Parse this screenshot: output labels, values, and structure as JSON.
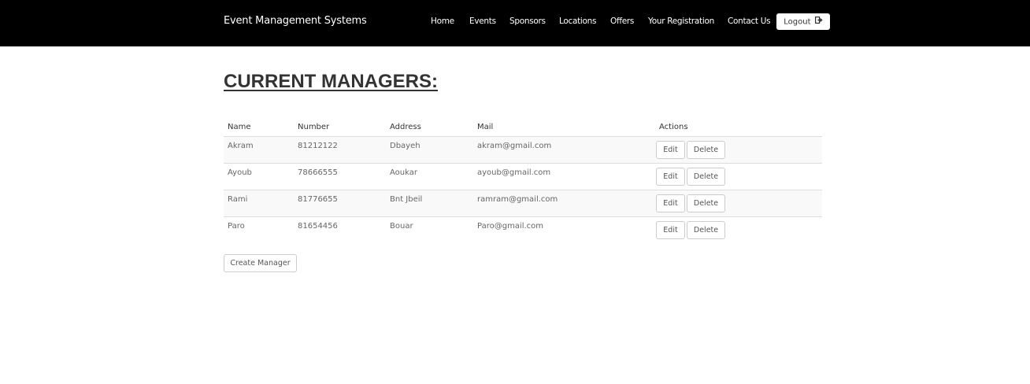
{
  "navbar": {
    "brand": "Event Management Systems",
    "links": [
      "Home",
      "Events",
      "Sponsors",
      "Locations",
      "Offers",
      "Your Registration",
      "Contact Us"
    ],
    "logout_label": "Logout"
  },
  "page": {
    "heading": "CURRENT MANAGERS:"
  },
  "table": {
    "headers": [
      "Name",
      "Number",
      "Address",
      "Mail",
      "Actions"
    ],
    "rows": [
      {
        "name": "Akram",
        "number": "81212122",
        "address": "Dbayeh",
        "mail": "akram@gmail.com"
      },
      {
        "name": "Ayoub",
        "number": "78666555",
        "address": "Aoukar",
        "mail": "ayoub@gmail.com"
      },
      {
        "name": "Rami",
        "number": "81776655",
        "address": "Bnt Jbeil",
        "mail": "ramram@gmail.com"
      },
      {
        "name": "Paro",
        "number": "81654456",
        "address": "Bouar",
        "mail": "Paro@gmail.com"
      }
    ],
    "edit_label": "Edit",
    "delete_label": "Delete"
  },
  "create_label": "Create Manager"
}
